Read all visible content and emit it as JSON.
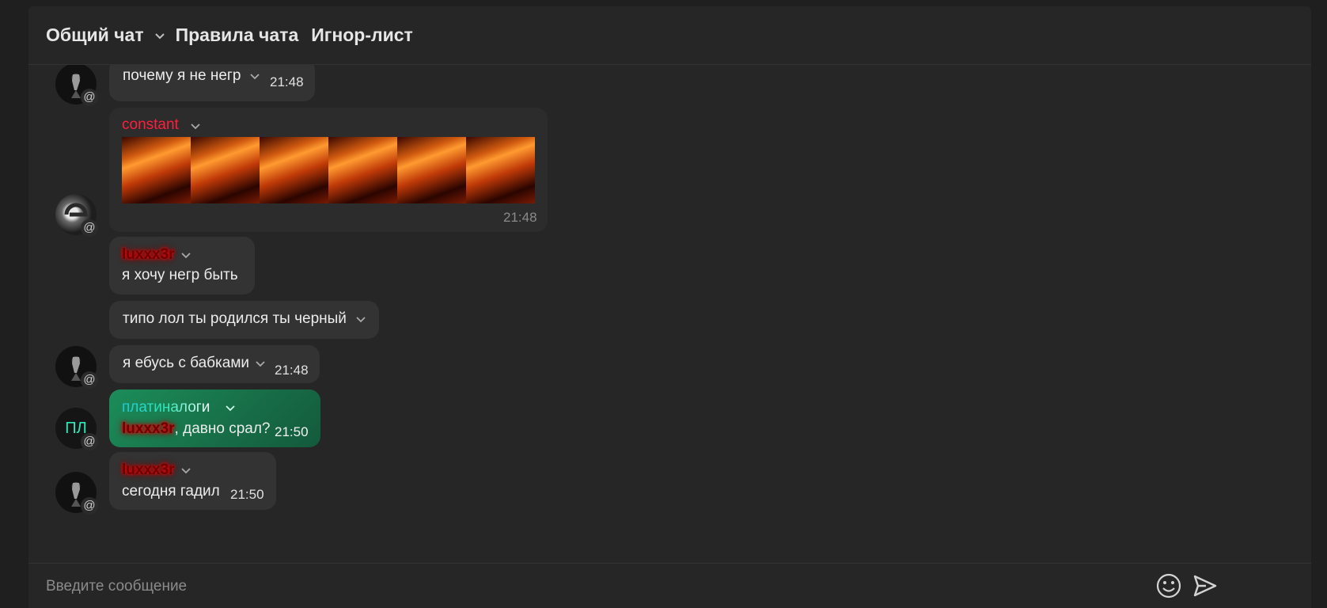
{
  "header": {
    "tabs": [
      {
        "label": "Общий чат"
      },
      {
        "label": "Правила чата"
      },
      {
        "label": "Игнор-лист"
      }
    ]
  },
  "messages": [
    {
      "text": "почему я не негр",
      "time": "21:48"
    },
    {
      "author": "constant",
      "time": "21:48",
      "author_color": "#ff1e3c"
    },
    {
      "author": "luxxx3r",
      "text": "я хочу негр быть"
    },
    {
      "text": "типо лол ты родился ты черный"
    },
    {
      "text": "я ебусь с бабками",
      "time": "21:48"
    },
    {
      "author": "платиналоги",
      "mention": "luxxx3r",
      "text": ", давно срал?",
      "time": "21:50",
      "avatar_initials": "ПЛ"
    },
    {
      "author": "luxxx3r",
      "text": "сегодня гадил",
      "time": "21:50"
    }
  ],
  "avatar_badge": "@",
  "composer": {
    "placeholder": "Введите сообщение"
  },
  "colors": {
    "background": "#1f1f1f",
    "panel": "#262626",
    "bubble": "#333333",
    "highlight_bubble": "#1a7a4c"
  },
  "icons": [
    "chevron-down-icon",
    "emoji-icon",
    "send-icon",
    "mention-icon"
  ]
}
